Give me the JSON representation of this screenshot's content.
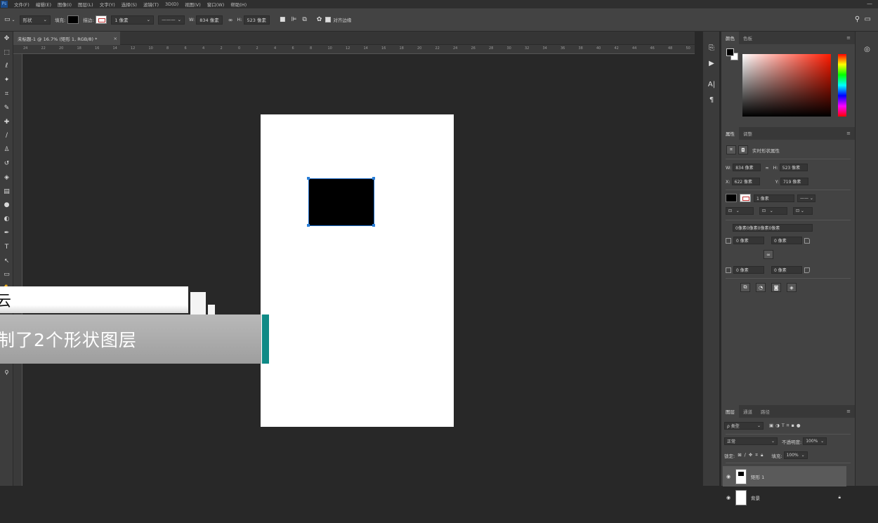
{
  "app": {
    "logo_text": "Ps"
  },
  "menu": [
    "文件(F)",
    "编辑(E)",
    "图像(I)",
    "图层(L)",
    "文字(Y)",
    "选择(S)",
    "滤镜(T)",
    "3D(D)",
    "视图(V)",
    "窗口(W)",
    "帮助(H)"
  ],
  "options_bar": {
    "mode": "形状",
    "fill_label": "填充:",
    "stroke_label": "描边:",
    "stroke_width": "1 像素",
    "w_label": "W:",
    "w_value": "834 像素",
    "h_label": "H:",
    "h_value": "523 像素",
    "align_edges_label": "对齐边缘"
  },
  "document_tab": {
    "title": "未标题-1 @ 16.7% (矩形 1, RGB/8) *",
    "close": "×"
  },
  "ruler_marks": [
    "24",
    "22",
    "20",
    "18",
    "16",
    "14",
    "12",
    "10",
    "8",
    "6",
    "4",
    "2",
    "0",
    "2",
    "4",
    "6",
    "8",
    "10",
    "12",
    "14",
    "16",
    "18",
    "20",
    "22",
    "24",
    "26",
    "28",
    "30",
    "32",
    "34",
    "36",
    "38",
    "40",
    "42",
    "44",
    "46",
    "48",
    "50"
  ],
  "panels": {
    "color_tabs": [
      "颜色",
      "色板"
    ],
    "properties_tabs": [
      "属性",
      "调整"
    ],
    "properties_title": "实时形状属性",
    "props": {
      "w_label": "W:",
      "w": "834 像素",
      "h_label": "H:",
      "h": "523 像素",
      "x_label": "X:",
      "x": "622 像素",
      "y_label": "Y:",
      "y": "719 像素",
      "stroke_width": "1 像素",
      "radius_all": "0像素0像素0像素0像素",
      "corner_tl": "0 像素",
      "corner_tr": "0 像素",
      "corner_bl": "0 像素",
      "corner_br": "0 像素"
    },
    "layers_tabs": [
      "图层",
      "通道",
      "路径"
    ],
    "layers": {
      "filter_kind": "ρ 类型",
      "blend_mode": "正常",
      "opacity_label": "不透明度:",
      "opacity": "100%",
      "lock_label": "锁定:",
      "fill_label": "填充:",
      "fill": "100%",
      "items": [
        {
          "name": "矩形 1"
        },
        {
          "name": "背景"
        }
      ]
    }
  },
  "overlay": {
    "caption_top": "云",
    "caption_main": "制了2个形状图层"
  },
  "colors": {
    "accent_teal": "#0f8a86",
    "selection_blue": "#2a7fd8"
  }
}
